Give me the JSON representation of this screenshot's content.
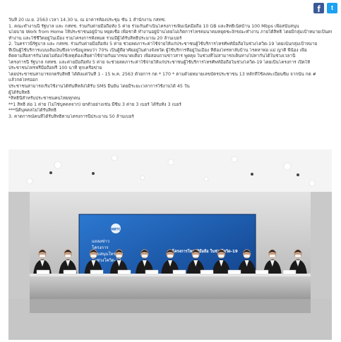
{
  "share": {
    "facebook_icon": "facebook-icon",
    "twitter_icon": "twitter-icon",
    "facebook_glyph": "f",
    "twitter_glyph": "t",
    "facebook_color": "#3b5998",
    "twitter_color": "#1da1f2"
  },
  "article": {
    "lines": [
      "วันที่ 20 เม.ย. 2563 เวลา 14.30 น. ณ อาคารห้องประชุม ชั้น 1 สำนักงาน กสทช.",
      "1. คณะทำงานนี้ รัฐบาล และ กสทช. ร่วมกับค่ายมือถือทั้ง 5 ค่าย ร่วมกันดำเนินโครงการเพิ่มเน็ตมือถือ 10 GB และสิทธิเน็ตบ้าน 100 Mbps เพื่อสนับสนุน",
      "นโยบาย Work from Home ให้ประชาชนอยู่บ้าน หยุดเชื้อ เพื่อชาติ ทำงานอยู่บ้านโดยไม่เกิดการโทรคมนาคมหยุดชะงักขณะทำงาน ภายใต้สิทธิ โดยมีกลุ่มเป้าหมายเป็นคน",
      "ทำงาน และใช้ชีวิตอยู่ในเมือง รวมโครงการทั้งหมด รวมมีผู้ได้รับสิทธิ์ประมาณ 20 ล้านเบอร์",
      "2. ในคราวนี้รัฐบาล และ กสทช. ร่วมกับค่ายมือถือทั้ง 5 ค่าย ช่วยลดภาระค่าใช้จ่ายให้แก่ประชาชนผู้ใช้บริการโทรศัพท์มือถือในช่วงโควิด-19 โดยเน้นกลุ่มเป้าหมาย",
      "ที่เป็นผู้ใช้บริการแบบเติมเงินซึ่งจากข้อมูลพบว่า 70% เป็นผู้ที่อาศัยอยู่ในต่างจังหวัด ผู้ใช้บริการที่อยู่ในเมือง ที่ต้องโทรหาลับบ้าน โรคหาพ่อ แม่ ญาติ พี่น้อง เพื่อ",
      "ติดตามสื่อสารกันโดยไม่ต้องใช้เหตุต้องเสียค่าใช้จ่ายกันมากขนาดเดียว เพื่อสอบถามข่าวสาร พูดคุย ในช่วงที่ไม่สามารถเดินทางไปหากันได้ในช่วงเวลานี้",
      "โครงการนี้ รัฐบาล กสทช. และค่ายมือถือทั้ง 5 ค่าย จะช่วยลดภาระค่าใช้จ่ายให้แก่ประชาชนผู้ใช้บริการโทรศัพท์มือถือในช่วงโควิด-19 โดยเป็นโครงการ เปิดให้",
      "ประชาชนโทรฟรีมือถือฟรี 100 นาที ทุกเครือข่าย",
      "โดยประชาชนสามารถกดรับสิทธิ์ ได้ตั้งแต่วันที่ 1 - 15 พ.ค. 2563 ด้วยการ กด * 170 * ตามด้วยหมายเลขบัตรประชาชน 13 หลักที่ใช้ลงทะเบียนซิม จากนั้น กด #",
      "แล้วกดโทรออก",
      "ประชาชนสามารถเริ่มใช้งานได้ทันทีหลังได้รับ SMS ยืนยัน โดยมีระยะเวลาการใช้งานได้ 45 วัน",
      "ผู้ได้รับสิทธิ์",
      "*สิทธิ์นี้สำหรับประชาชนคนไทยทุกคน",
      "**1 สิทธิ์ ต่อ 1 ค่าย (ไม่ใช่บุคคลจาก) ยกตัวอย่างเช่น มีซิม 3 ค่าย 3 เบอร์ ได้รับทั้ง 3 เบอร์",
      "***นิติบุคคลไม่ได้รับสิทธิ์",
      "3. คาดการณ์คนที่ได้รับสิทธิ์ตามโครงการนี้ประมาณ 50 ล้านเบอร์"
    ]
  },
  "photo": {
    "screen_logo_mark": "NBTC",
    "screen_lines": [
      "แถลงข่าว",
      "โครงการ",
      "สนับสนุนโทรฟรี",
      "ในช่วงโควิด-19"
    ],
    "screen_headline": "โครงการโทรฟรีมือถือ ในช่วงโควิด-19",
    "colors": {
      "screen": "#1d5fb0",
      "screen_dark": "#0f3c7e",
      "ceiling": "#f3f3f3",
      "wall": "#d9d9d9",
      "table_cloth": "#bdbdbd",
      "floor": "#cfcfcf",
      "suit": "#1a1a1a",
      "skin": "#c59a7e"
    },
    "people_count": 11
  }
}
